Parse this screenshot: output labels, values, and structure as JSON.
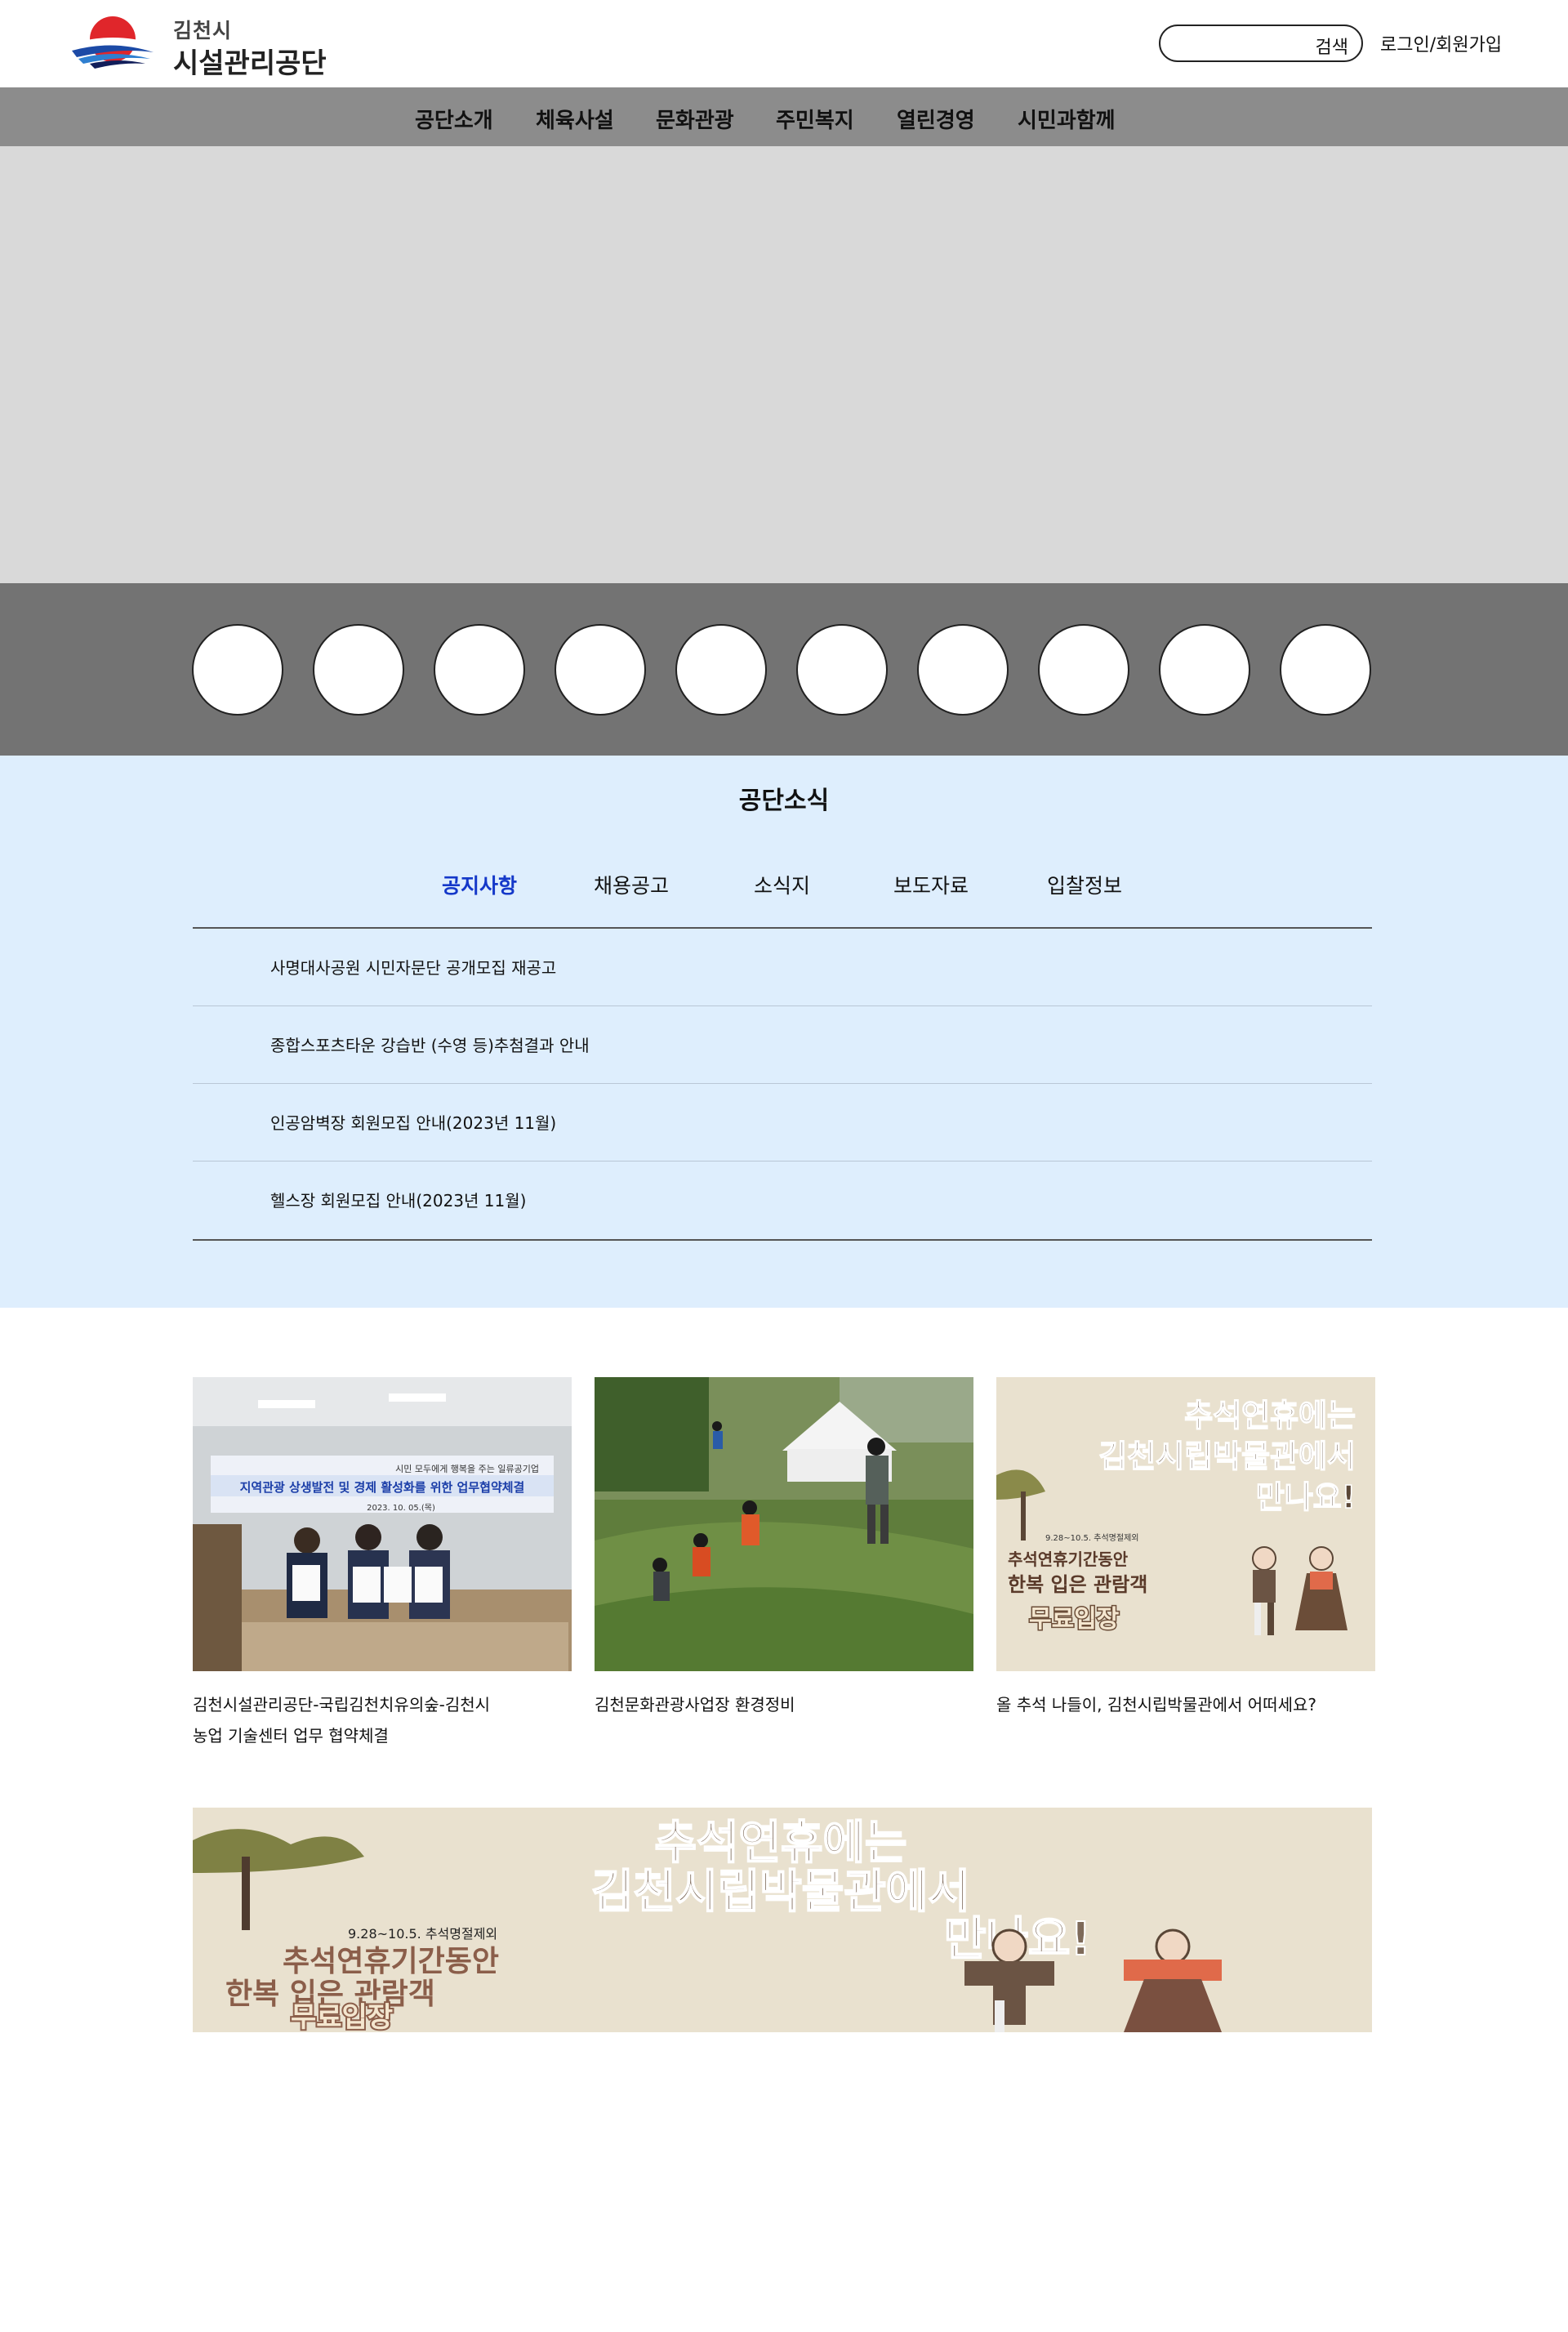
{
  "header": {
    "logo_small": "김천시",
    "logo_big": "시설관리공단",
    "search_placeholder": "",
    "search_button": "검색",
    "login_link": "로그인/회원가입"
  },
  "nav": {
    "items": [
      "공단소개",
      "체육사설",
      "문화관광",
      "주민복지",
      "열린경영",
      "시민과함께"
    ]
  },
  "quick_links": {
    "count": 10
  },
  "news": {
    "title": "공단소식",
    "tabs": [
      {
        "label": "공지사항",
        "active": true
      },
      {
        "label": "채용공고",
        "active": false
      },
      {
        "label": "소식지",
        "active": false
      },
      {
        "label": "보도자료",
        "active": false
      },
      {
        "label": "입찰정보",
        "active": false
      }
    ],
    "items": [
      "사명대사공원 시민자문단 공개모집 재공고",
      "종합스포츠타운 강습반 (수영 등)추첨결과 안내",
      "인공암벽장 회원모집 안내(2023년 11월)",
      "헬스장 회원모집 안내(2023년 11월)"
    ]
  },
  "gallery": {
    "cards": [
      {
        "caption_line1": "김천시설관리공단-국립김천치유의숲-김천시",
        "caption_line2": "농업 기술센터 업무 협약체결",
        "photo_banner_sub": "시민 모두에게 행복을 주는 일류공기업",
        "photo_banner": "지역관광 상생발전 및 경제 활성화를 위한 업무협약체결",
        "photo_date": "2023. 10. 05.(목)"
      },
      {
        "caption_line1": "김천문화관광사업장 환경정비"
      },
      {
        "caption_line1": "올 추석 나들이, 김천시립박물관에서 어떠세요?",
        "poster_line1": "추석연휴에는",
        "poster_line2": "김천시립박물관에서",
        "poster_line3": "만나요!",
        "poster_date": "9.28~10.5. 추석명절제외",
        "poster_sub1": "추석연휴기간동안",
        "poster_sub2": "한복 입은 관람객",
        "poster_free": "무료입장"
      }
    ]
  },
  "banner": {
    "line1": "추석연휴에는",
    "line2": "김천시립박물관에서",
    "line3": "만나요!",
    "date": "9.28~10.5. 추석명절제외",
    "sub1": "추석연휴기간동안",
    "sub2": "한복 입은 관람객",
    "free": "무료입장"
  },
  "colors": {
    "nav_bg": "#8c8c8c",
    "hero_bg": "#d9d9d9",
    "quick_bg": "#737373",
    "news_bg": "#deeefd",
    "active_tab": "#1438c9",
    "poster_bg": "#e9e1cf"
  }
}
